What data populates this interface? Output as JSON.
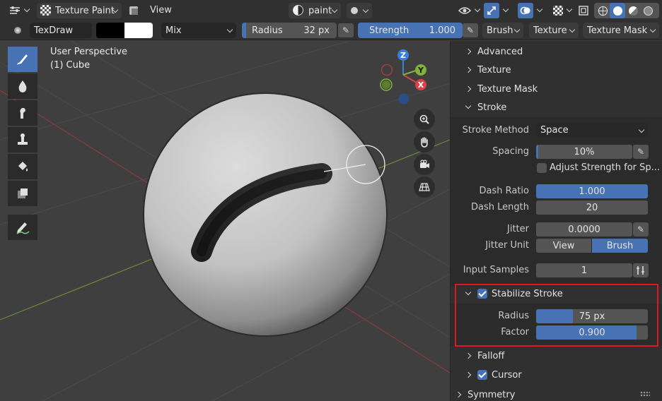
{
  "header": {
    "mode_label": "Texture Paint",
    "view_menu": "View",
    "material_slot": "paint"
  },
  "tool_settings": {
    "brush_name": "TexDraw",
    "blend_mode": "Mix",
    "radius_label": "Radius",
    "radius_value": "32 px",
    "strength_label": "Strength",
    "strength_value": "1.000",
    "strength_fraction": 1.0,
    "menu_brush": "Brush",
    "menu_texture": "Texture",
    "menu_texture_mask": "Texture Mask"
  },
  "viewport": {
    "perspective": "User Perspective",
    "object": "(1) Cube",
    "gizmo": {
      "z": "Z",
      "y": "Y",
      "x": "X"
    }
  },
  "panel": {
    "advanced": "Advanced",
    "texture": "Texture",
    "texture_mask": "Texture Mask",
    "stroke": "Stroke",
    "stroke_method_label": "Stroke Method",
    "stroke_method_value": "Space",
    "spacing_label": "Spacing",
    "spacing_value": "10%",
    "spacing_fraction": 0.1,
    "adjust_strength_label": "Adjust Strength for Sp...",
    "dash_ratio_label": "Dash Ratio",
    "dash_ratio_value": "1.000",
    "dash_length_label": "Dash Length",
    "dash_length_value": "20",
    "jitter_label": "Jitter",
    "jitter_value": "0.0000",
    "jitter_unit_label": "Jitter Unit",
    "jitter_unit_view": "View",
    "jitter_unit_brush": "Brush",
    "input_samples_label": "Input Samples",
    "input_samples_value": "1",
    "stabilize_label": "Stabilize Stroke",
    "stab_radius_label": "Radius",
    "stab_radius_value": "75 px",
    "stab_radius_fraction": 0.33,
    "stab_factor_label": "Factor",
    "stab_factor_value": "0.900",
    "stab_factor_fraction": 0.9,
    "falloff": "Falloff",
    "cursor": "Cursor",
    "symmetry": "Symmetry"
  },
  "colors": {
    "accent": "#4772b3",
    "highlight_box": "#e0191f"
  }
}
